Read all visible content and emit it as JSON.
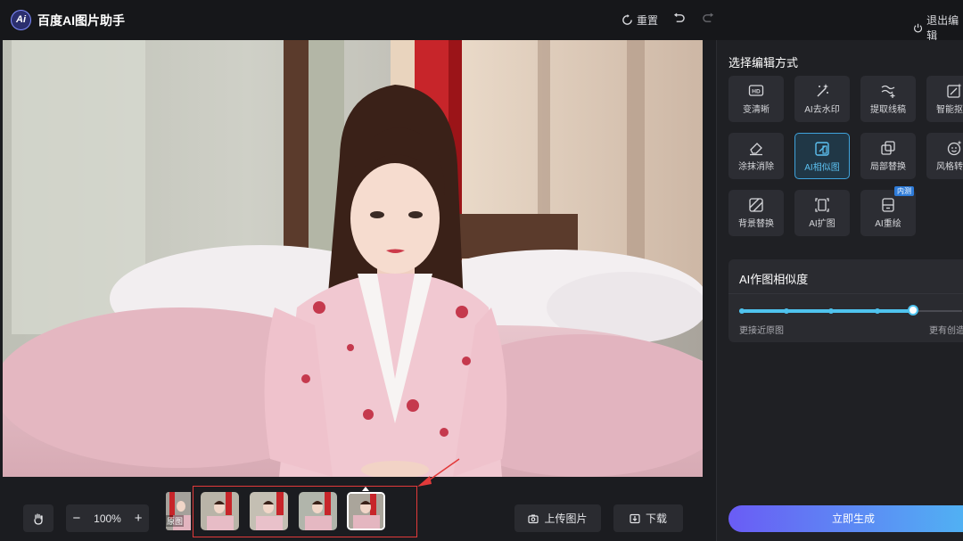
{
  "app": {
    "logo_text": "Ai",
    "title": "百度AI图片助手"
  },
  "toolbar": {
    "reset_label": "重置",
    "exit_label": "退出编辑"
  },
  "panel": {
    "title": "选择编辑方式",
    "modes": [
      {
        "label": "变清晰",
        "icon": "hd-icon",
        "active": false
      },
      {
        "label": "AI去水印",
        "icon": "magic-wand-icon",
        "active": false
      },
      {
        "label": "提取线稿",
        "icon": "line-draft-icon",
        "active": false
      },
      {
        "label": "智能抠图",
        "icon": "smart-cutout-icon",
        "active": false
      },
      {
        "label": "涂抹消除",
        "icon": "eraser-icon",
        "active": false
      },
      {
        "label": "AI相似图",
        "icon": "similar-image-icon",
        "active": true
      },
      {
        "label": "局部替换",
        "icon": "partial-replace-icon",
        "active": false
      },
      {
        "label": "风格转换",
        "icon": "style-transfer-icon",
        "active": false
      },
      {
        "label": "背景替换",
        "icon": "background-replace-icon",
        "active": false
      },
      {
        "label": "AI扩图",
        "icon": "expand-image-icon",
        "active": false
      },
      {
        "label": "AI重绘",
        "icon": "redraw-icon",
        "active": false,
        "badge": "内测"
      }
    ],
    "similarity": {
      "title": "AI作图相似度",
      "left_label": "更接近原图",
      "right_label": "更有创造力",
      "level": 0.78
    },
    "generate_label": "立即生成"
  },
  "bottom": {
    "zoom": "100%",
    "zoom_out": "−",
    "zoom_in": "+",
    "upload_label": "上传图片",
    "download_label": "下载",
    "partial_thumb_text": "原图"
  },
  "colors": {
    "accent": "#4fb6f3",
    "annotation": "#e23a3a",
    "active_mode": "#3fa3dc"
  }
}
